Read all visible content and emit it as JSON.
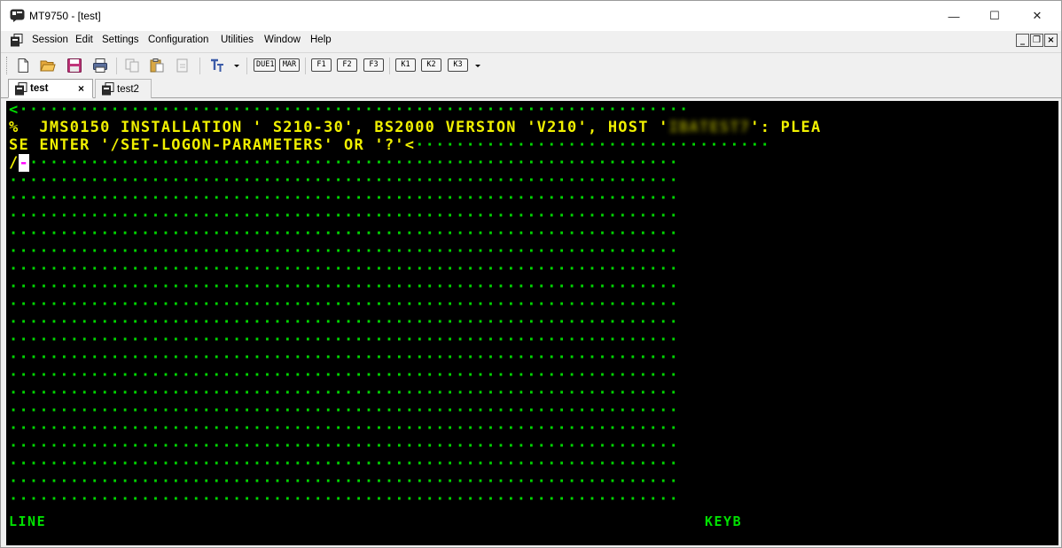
{
  "window": {
    "title": "MT9750 - [test]",
    "minimize_glyph": "—",
    "maximize_glyph": "☐",
    "close_glyph": "✕"
  },
  "menu": {
    "items": [
      "Session",
      "Edit",
      "Settings",
      "Configuration",
      "Utilities",
      "Window",
      "Help"
    ],
    "mdi_controls": [
      "_",
      "❐",
      "×"
    ]
  },
  "toolbar": {
    "icons": [
      "new-document-icon",
      "open-folder-icon",
      "save-icon",
      "print-icon",
      "copy-icon",
      "paste-icon",
      "paste-special-icon",
      "font-icon"
    ],
    "keys": [
      "DUE1",
      "MAR",
      "F1",
      "F2",
      "F3",
      "K1",
      "K2",
      "K3"
    ]
  },
  "tabs": [
    {
      "label": "test",
      "active": true,
      "close_glyph": "×"
    },
    {
      "label": "test2",
      "active": false
    }
  ],
  "terminal": {
    "rows": [
      {
        "prefix": "<",
        "prefix_color": "green",
        "text": ""
      },
      {
        "prefix": "%",
        "prefix_color": "yellow",
        "text": "  JMS0150 INSTALLATION ' S210-30', BS2000 VERSION 'V210', HOST '",
        "blurred": "IBATEST7",
        "suffix": "': PLEA"
      },
      {
        "prefix": "",
        "prefix_color": "yellow",
        "text": "SE ENTER '/SET-LOGON-PARAMETERS' OR '?'<"
      },
      {
        "prefix": "/",
        "prefix_color": "yellow",
        "cursor_char": "-"
      }
    ],
    "status_left": "LINE",
    "status_right": "KEYB"
  },
  "colors": {
    "terminal_bg": "#000000",
    "terminal_green": "#00e000",
    "terminal_yellow": "#f0f000"
  }
}
